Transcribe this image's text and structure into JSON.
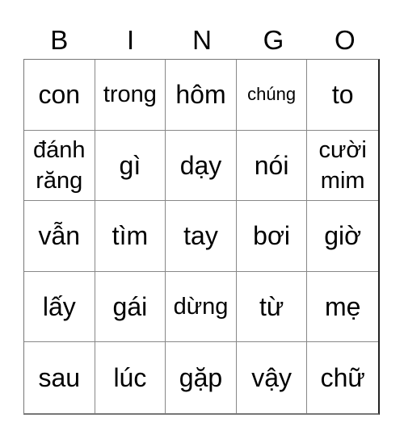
{
  "header": {
    "letters": [
      "B",
      "I",
      "N",
      "G",
      "O"
    ]
  },
  "cells": [
    "con",
    "trong",
    "hôm",
    "chúng",
    "to",
    "đánh răng",
    "gì",
    "dạy",
    "nói",
    "cười mim",
    "vẫn",
    "tìm",
    "tay",
    "bơi",
    "giờ",
    "lấy",
    "gái",
    "dừng",
    "từ",
    "mẹ",
    "sau",
    "lúc",
    "gặp",
    "vậy",
    "chữ"
  ]
}
